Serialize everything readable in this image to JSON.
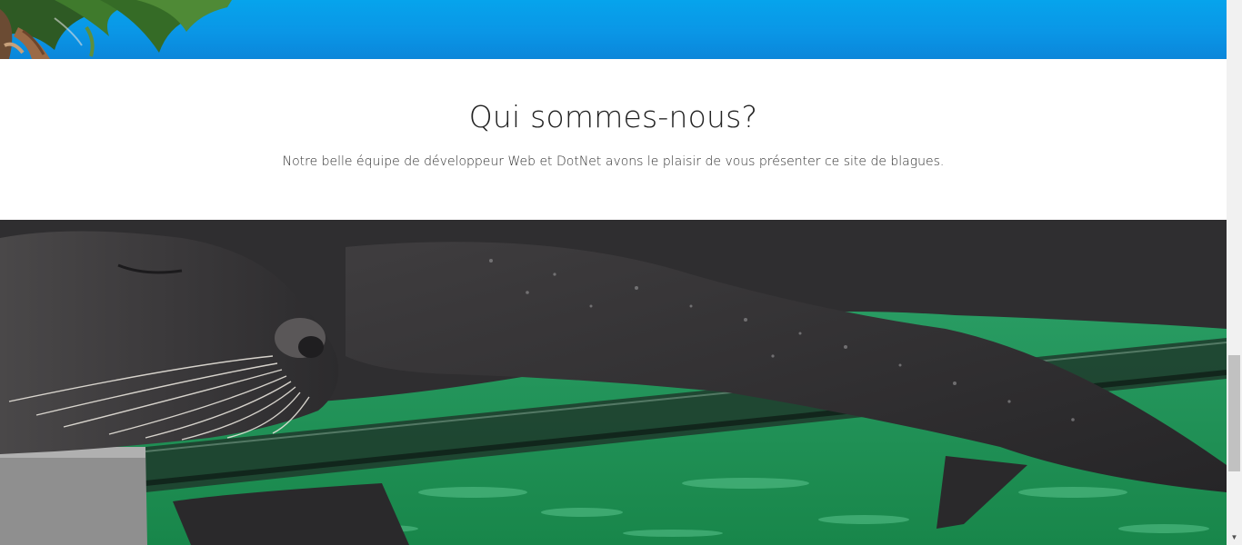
{
  "page": {
    "about": {
      "title": "Qui sommes-nous?",
      "text": "Notre belle équipe de développeur Web et DotNet avons le plaisir de vous présenter ce site de blagues."
    },
    "images": {
      "top_banner": "palm-tree-sky-photo",
      "main_photo": "sleeping-sea-lion-photo"
    },
    "scrollbar": {
      "arrow_down_icon": "▼"
    }
  },
  "colors": {
    "sky": "#0a96e6",
    "text": "#222222",
    "water": "#1f9a5a",
    "sea_lion": "#3a3a3c"
  }
}
